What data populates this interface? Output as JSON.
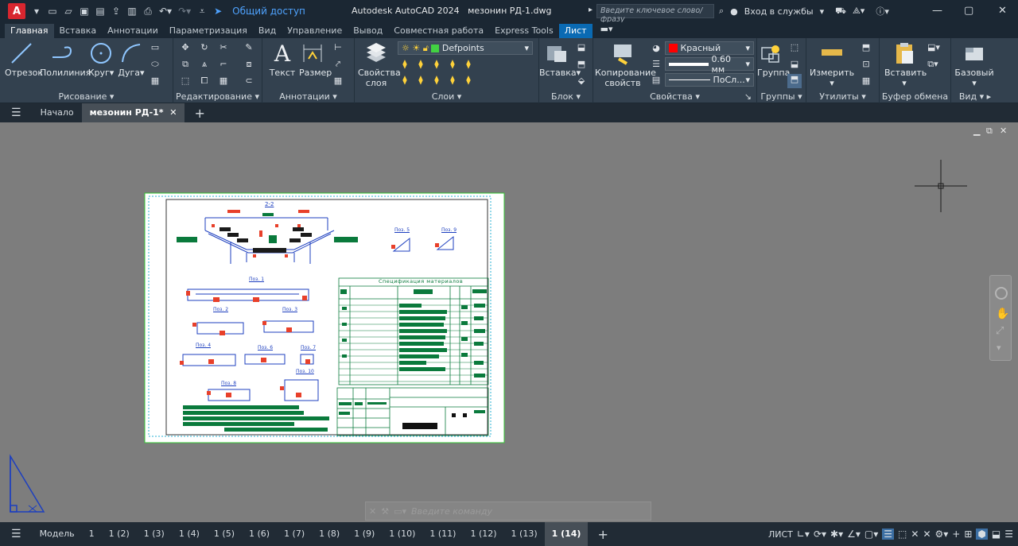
{
  "window": {
    "app_title": "Autodesk AutoCAD 2024",
    "file_title": "мезонин РД-1.dwg",
    "share": "Общий доступ",
    "search_placeholder": "Введите ключевое слово/фразу",
    "sign_in": "Вход в службы",
    "app_logo": "A"
  },
  "ribbon_tabs": [
    "Главная",
    "Вставка",
    "Аннотации",
    "Параметризация",
    "Вид",
    "Управление",
    "Вывод",
    "Совместная работа",
    "Express Tools",
    "Лист"
  ],
  "ribbon": {
    "draw": {
      "title": "Рисование",
      "line": "Отрезок",
      "polyline": "Полилиния",
      "circle": "Круг",
      "arc": "Дуга"
    },
    "modify": {
      "title": "Редактирование"
    },
    "annotation": {
      "title": "Аннотации",
      "text": "Текст",
      "dimension": "Размер"
    },
    "layers": {
      "title": "Слои",
      "props": "Свойства",
      "props2": "слоя",
      "current_layer": "Defpoints"
    },
    "block": {
      "title": "Блок",
      "insert": "Вставка"
    },
    "properties": {
      "title": "Свойства",
      "copy": "Копирование",
      "copy2": "свойств",
      "color": "Красный",
      "lineweight": "0.60 мм",
      "linetype": "ПоСл..."
    },
    "groups": {
      "title": "Группы",
      "group": "Группа"
    },
    "utilities": {
      "title": "Утилиты",
      "measure": "Измерить"
    },
    "clipboard": {
      "title": "Буфер обмена",
      "paste": "Вставить"
    },
    "view": {
      "title": "Вид",
      "base": "Базовый"
    }
  },
  "doc_tabs": {
    "start": "Начало",
    "active": "мезонин РД-1*"
  },
  "drawing": {
    "section_label": "2-2",
    "spec_title": "Спецификация материалов",
    "parts": [
      "Поз. 1",
      "Поз. 2",
      "Поз. 3",
      "Поз. 4",
      "Поз. 5",
      "Поз. 6",
      "Поз. 7",
      "Поз. 8",
      "Поз. 9",
      "Поз. 10"
    ]
  },
  "command_placeholder": "Введите команду",
  "layout_tabs": [
    "Модель",
    "1",
    "1 (2)",
    "1 (3)",
    "1 (4)",
    "1 (5)",
    "1 (6)",
    "1 (7)",
    "1 (8)",
    "1 (9)",
    "1 (10)",
    "1 (11)",
    "1 (12)",
    "1 (13)",
    "1 (14)"
  ],
  "active_layout": "1 (14)",
  "status": {
    "space": "ЛИСТ"
  },
  "colors": {
    "accent": "#0a6ab3",
    "canvas": "#7d7d7d",
    "drawing_green": "#0a7a3c",
    "red": "#e8402a"
  }
}
